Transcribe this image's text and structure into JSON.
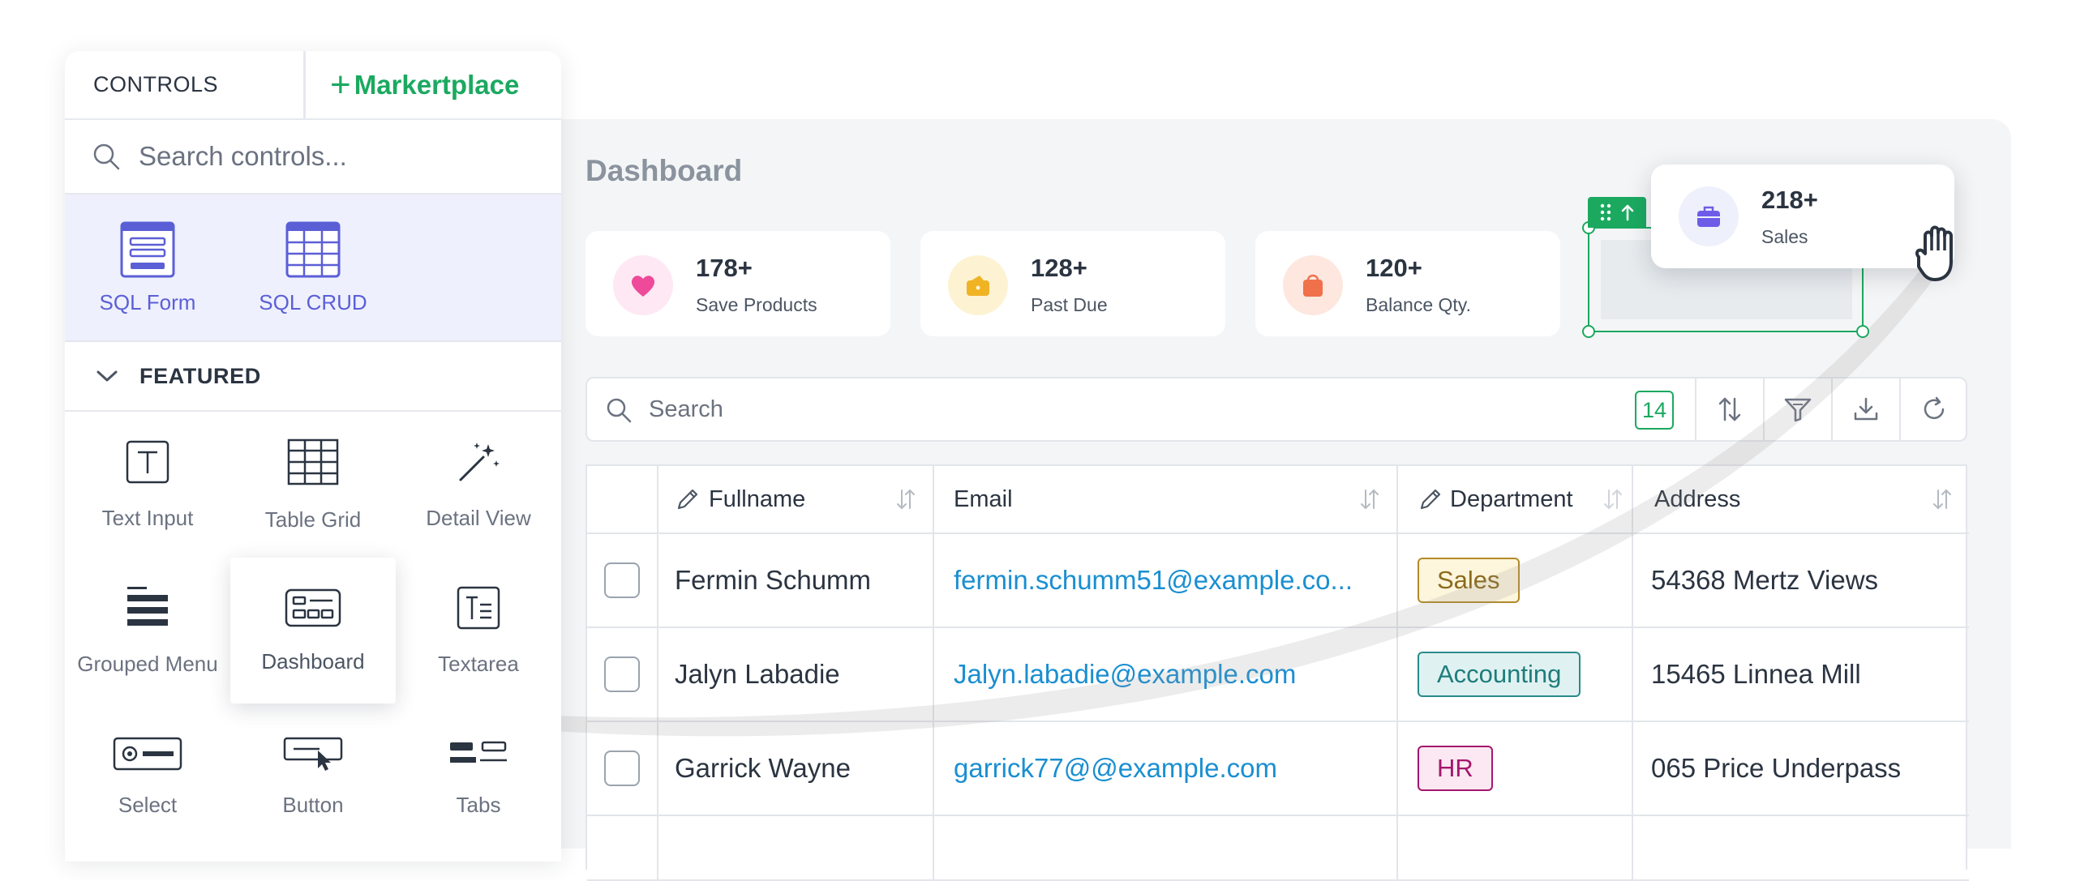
{
  "panel": {
    "tabs": {
      "controls": "CONTROLS",
      "marketplace": "Markertplace",
      "marketplace_plus": "+"
    },
    "search_placeholder": "Search controls...",
    "sql_items": [
      "SQL Form",
      "SQL CRUD"
    ],
    "featured_label": "FEATURED",
    "controls": [
      "Text Input",
      "Table Grid",
      "Detail View",
      "Grouped Menu",
      "Dashboard",
      "Textarea",
      "Select",
      "Button",
      "Tabs"
    ]
  },
  "dashboard": {
    "title": "Dashboard",
    "stats": [
      {
        "value": "178+",
        "label": "Save Products",
        "icon": "heart-icon"
      },
      {
        "value": "128+",
        "label": "Past Due",
        "icon": "wallet-icon"
      },
      {
        "value": "120+",
        "label": "Balance Qty.",
        "icon": "bag-icon"
      }
    ],
    "floating_stat": {
      "value": "218+",
      "label": "Sales",
      "icon": "briefcase-icon"
    },
    "search_placeholder": "Search",
    "record_count": "14",
    "table": {
      "columns": [
        "Fullname",
        "Email",
        "Department",
        "Address"
      ],
      "rows": [
        {
          "name": "Fermin Schumm",
          "email": "fermin.schumm51@example.co...",
          "department": "Sales",
          "address": "54368 Mertz Views"
        },
        {
          "name": "Jalyn Labadie",
          "email": "Jalyn.labadie@example.com",
          "department": "Accounting",
          "address": "15465 Linnea Mill"
        },
        {
          "name": "Garrick Wayne",
          "email": "garrick77@@example.com",
          "department": "HR",
          "address": "065 Price Underpass"
        }
      ]
    }
  },
  "colors": {
    "accent_green": "#1ba960",
    "sql_purple": "#5b5fd6",
    "email_blue": "#1a8fd1",
    "dept_sales": "#b38a2a",
    "dept_accounting": "#2b8a8a",
    "dept_hr": "#a3176e"
  }
}
